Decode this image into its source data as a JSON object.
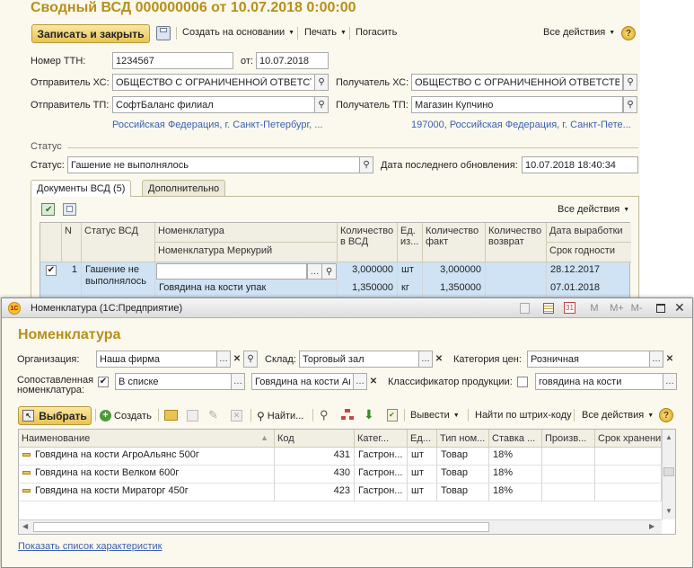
{
  "main": {
    "title": "Сводный ВСД 000000006 от 10.07.2018 0:00:00",
    "toolbar": {
      "save_close": "Записать и закрыть",
      "create_based": "Создать на основании",
      "print": "Печать",
      "cancel": "Погасить",
      "all_actions": "Все действия"
    },
    "fields": {
      "ttn_label": "Номер ТТН:",
      "ttn_value": "1234567",
      "from_label": "от:",
      "from_value": "10.07.2018",
      "sender_hs_label": "Отправитель ХС:",
      "sender_hs_value": "ОБЩЕСТВО С ОГРАНИЧЕННОЙ ОТВЕТСТВЕН",
      "receiver_hs_label": "Получатель ХС:",
      "receiver_hs_value": "ОБЩЕСТВО С ОГРАНИЧЕННОЙ ОТВЕТСТВЕН",
      "sender_tp_label": "Отправитель ТП:",
      "sender_tp_value": "СофтБаланс филиал",
      "receiver_tp_label": "Получатель ТП:",
      "receiver_tp_value": "Магазин Купчино",
      "sender_address": "Российская Федерация, г. Санкт-Петербург, ...",
      "receiver_address": "197000, Российская Федерация, г. Санкт-Пете...",
      "status_group": "Статус",
      "status_label": "Статус:",
      "status_value": "Гашение не выполнялось",
      "last_update_label": "Дата последнего обновления:",
      "last_update_value": "10.07.2018 18:40:34"
    },
    "tabs": [
      "Документы ВСД (5)",
      "Дополнительно"
    ],
    "grid_all_actions": "Все действия",
    "grid": {
      "headers": {
        "n": "N",
        "status": "Статус ВСД",
        "nomenclature": "Номенклатура",
        "nomenclature_merc": "Номенклатура Меркурий",
        "qty_vsd": "Количество в ВСД",
        "unit": "Ед. из...",
        "qty_fact": "Количество факт",
        "qty_return": "Количество возврат",
        "prod_date": "Дата выработки",
        "shelf": "Срок годности"
      },
      "row": {
        "n": "1",
        "status": "Гашение не выполнялось",
        "nomenclature": "",
        "nomenclature_merc": "Говядина на кости упак",
        "qty_vsd_1": "3,000000",
        "qty_vsd_2": "1,350000",
        "unit_1": "шт",
        "unit_2": "кг",
        "qty_fact_1": "3,000000",
        "qty_fact_2": "1,350000",
        "prod_date": "28.12.2017",
        "shelf": "07.01.2018"
      }
    }
  },
  "dialog": {
    "window_title": "Номенклатура (1С:Предприятие)",
    "heading": "Номенклатура",
    "org_label": "Организация:",
    "org_value": "Наша фирма",
    "warehouse_label": "Склад:",
    "warehouse_value": "Торговый зал",
    "price_label": "Категория цен:",
    "price_value": "Розничная",
    "mapped_label_1": "Сопоставленная",
    "mapped_label_2": "номенклатура:",
    "mapped_value": "В списке",
    "mapped_value2": "Говядина на кости Аг",
    "classifier_label": "Классификатор продукции:",
    "classifier_value": "говядина на кости",
    "toolbar": {
      "select": "Выбрать",
      "create": "Создать",
      "find": "Найти...",
      "output": "Вывести",
      "find_barcode": "Найти по штрих-коду",
      "all_actions": "Все действия"
    },
    "columns": [
      "Наименование",
      "Код",
      "Катег...",
      "Ед...",
      "Тип ном...",
      "Ставка ...",
      "Произв...",
      "Срок хранения"
    ],
    "rows": [
      {
        "name": "Говядина на кости АгроАльянс 500г",
        "code": "431",
        "cat": "Гастрон...",
        "unit": "шт",
        "type": "Товар",
        "rate": "18%"
      },
      {
        "name": "Говядина на кости Велком 600г",
        "code": "430",
        "cat": "Гастрон...",
        "unit": "шт",
        "type": "Товар",
        "rate": "18%"
      },
      {
        "name": "Говядина на кости Мираторг 450г",
        "code": "423",
        "cat": "Гастрон...",
        "unit": "шт",
        "type": "Товар",
        "rate": "18%"
      }
    ],
    "show_characteristics": "Показать список характеристик",
    "titlebar_buttons": [
      "M",
      "M+",
      "M-"
    ]
  },
  "colors": {
    "accent": "#b78f1a",
    "link": "#3a5fb0",
    "selection": "#cfe3f5"
  }
}
